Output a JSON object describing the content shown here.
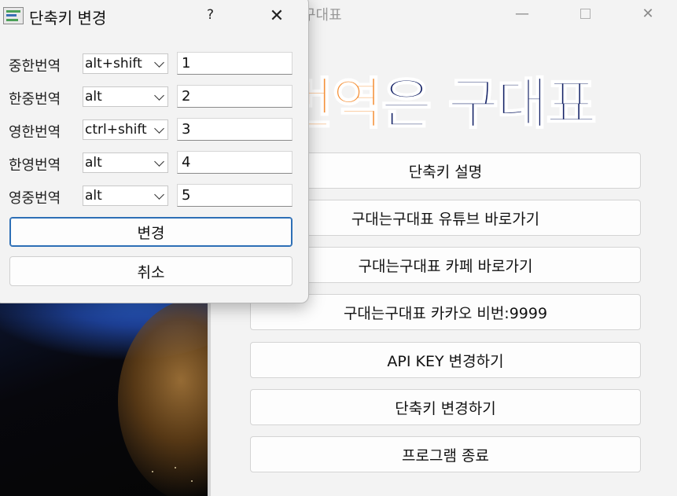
{
  "main_window": {
    "title": "구대표",
    "banner": {
      "part1": "번역",
      "part2": "은 구대표"
    },
    "buttons": [
      "단축키 설명",
      "구대는구대표 유튜브 바로가기",
      "구대는구대표 카페 바로가기",
      "구대는구대표 카카오 비번:9999",
      "API KEY 변경하기",
      "단축키 변경하기",
      "프로그램 종료"
    ]
  },
  "dialog": {
    "title": "단축키 변경",
    "help_label": "?",
    "close_label": "✕",
    "rows": [
      {
        "label": "중한번역",
        "modifier": "alt+shift",
        "key": "1"
      },
      {
        "label": "한중번역",
        "modifier": "alt",
        "key": "2"
      },
      {
        "label": "영한번역",
        "modifier": "ctrl+shift",
        "key": "3"
      },
      {
        "label": "한영번역",
        "modifier": "alt",
        "key": "4"
      },
      {
        "label": "영중번역",
        "modifier": "alt",
        "key": "5"
      }
    ],
    "change_button": "변경",
    "cancel_button": "취소"
  },
  "colors": {
    "banner_orange": "#f5923a",
    "banner_navy": "#142266",
    "focus_blue": "#2d6fb6"
  }
}
